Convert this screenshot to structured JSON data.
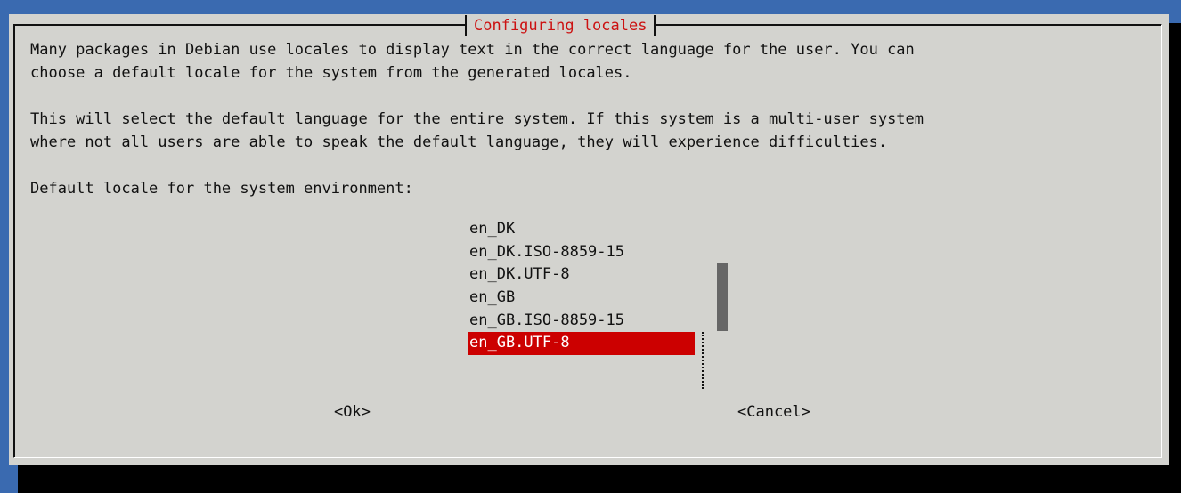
{
  "dialog": {
    "title": "Configuring locales",
    "paragraph1_line1": "Many packages in Debian use locales to display text in the correct language for the user. You can",
    "paragraph1_line2": "choose a default locale for the system from the generated locales.",
    "paragraph2_line1": "This will select the default language for the entire system. If this system is a multi-user system",
    "paragraph2_line2": "where not all users are able to speak the default language, they will experience difficulties.",
    "prompt": "Default locale for the system environment:"
  },
  "locale_list": {
    "items": [
      "en_DK",
      "en_DK.ISO-8859-15",
      "en_DK.UTF-8",
      "en_GB",
      "en_GB.ISO-8859-15",
      "en_GB.UTF-8"
    ],
    "selected": "en_GB.UTF-8"
  },
  "buttons": {
    "ok": "<Ok>",
    "cancel": "<Cancel>"
  },
  "colors": {
    "desktop": "#3a6ab0",
    "dialog_bg": "#d3d3cf",
    "title_text": "#cc1111",
    "selection": "#cc0000",
    "scrollbar_thumb": "#666666"
  }
}
